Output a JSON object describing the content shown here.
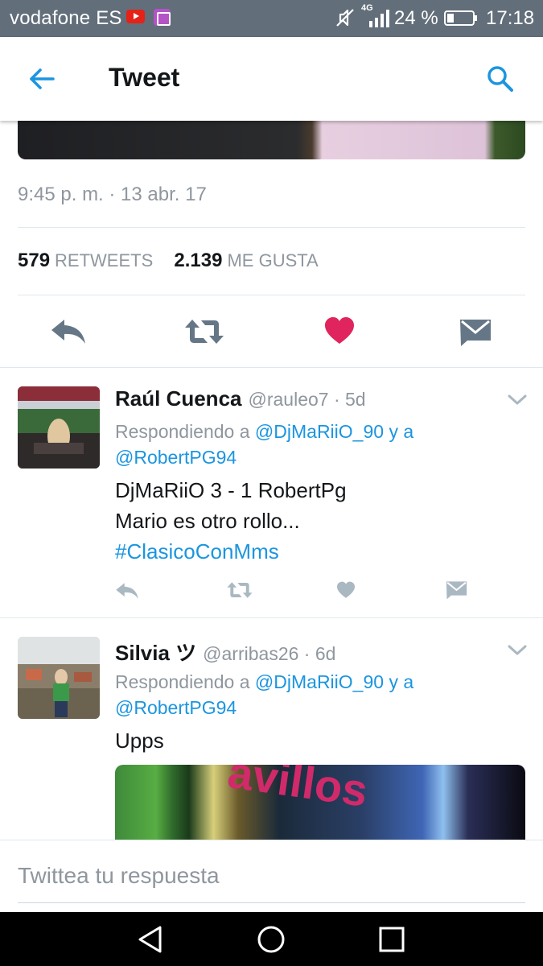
{
  "status_bar": {
    "carrier": "vodafone ES",
    "network": "4G",
    "battery": "24 %",
    "time": "17:18",
    "icons": [
      "youtube-icon",
      "gallery-icon",
      "mute-icon",
      "signal-icon",
      "battery-icon"
    ]
  },
  "header": {
    "title": "Tweet",
    "back_icon": "arrow-left-icon",
    "search_icon": "search-icon"
  },
  "main_tweet": {
    "timestamp": "9:45 p. m. · 13 abr. 17",
    "retweets_count": "579",
    "retweets_label": "RETWEETS",
    "likes_count": "2.139",
    "likes_label": "ME GUSTA",
    "actions": [
      "reply-icon",
      "retweet-icon",
      "like-icon",
      "direct-message-icon"
    ]
  },
  "replies": [
    {
      "name": "Raúl Cuenca",
      "handle": "@rauleo7",
      "age": "· 5d",
      "replying_prefix": "Respondiendo a",
      "replying_user1": "@DjMaRiiO_90",
      "replying_joiner": "y a",
      "replying_user2": "@RobertPG94",
      "text_line1": "DjMaRiiO 3 - 1 RobertPg",
      "text_line2": "Mario es otro rollo...",
      "hashtag": "#ClasicoConMms"
    },
    {
      "name": "Silvia ツ",
      "handle": "@arribas26",
      "age": "· 6d",
      "replying_prefix": "Respondiendo a",
      "replying_user1": "@DjMaRiiO_90",
      "replying_joiner": "y a",
      "replying_user2": "@RobertPG94",
      "text_line1": "Upps",
      "media_text": "avillos"
    }
  ],
  "composer": {
    "placeholder": "Twittea tu respuesta"
  },
  "nav_bar": {
    "buttons": [
      "back-triangle-icon",
      "home-circle-icon",
      "recents-square-icon"
    ]
  },
  "colors": {
    "status_bar": "#626e7a",
    "accent_blue": "#1b95e0",
    "like_red": "#e0245e",
    "muted_gray": "#8f969e",
    "icon_gray": "#657786",
    "light_icon_gray": "#aab8c2"
  }
}
